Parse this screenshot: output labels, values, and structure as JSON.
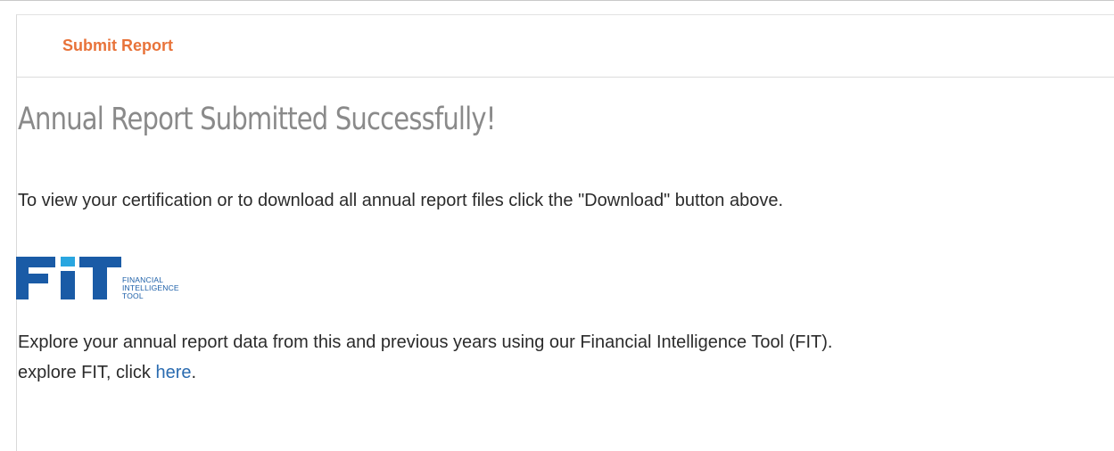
{
  "panel": {
    "title": "Submit Report"
  },
  "main": {
    "heading": "Annual Report Submitted Successfully!",
    "certification_text": "To view your certification or to download all annual report files click the \"Download\" button above.",
    "explore_text": "Explore your annual report data from this and previous years using our Financial Intelligence Tool (FIT).",
    "explore_link_prefix": "explore FIT, click ",
    "explore_link_label": "here",
    "explore_link_suffix": "."
  },
  "logo": {
    "mark": "FIT",
    "line1": "FINANCIAL",
    "line2": "INTELLIGENCE",
    "line3": "TOOL",
    "colors": {
      "primary": "#1a5ba6",
      "accent": "#29a6e0"
    }
  },
  "colors": {
    "accent_orange": "#e8733a",
    "heading_gray": "#8a8a8a",
    "body_text": "#2b2b2b",
    "link": "#2a6bb0"
  }
}
